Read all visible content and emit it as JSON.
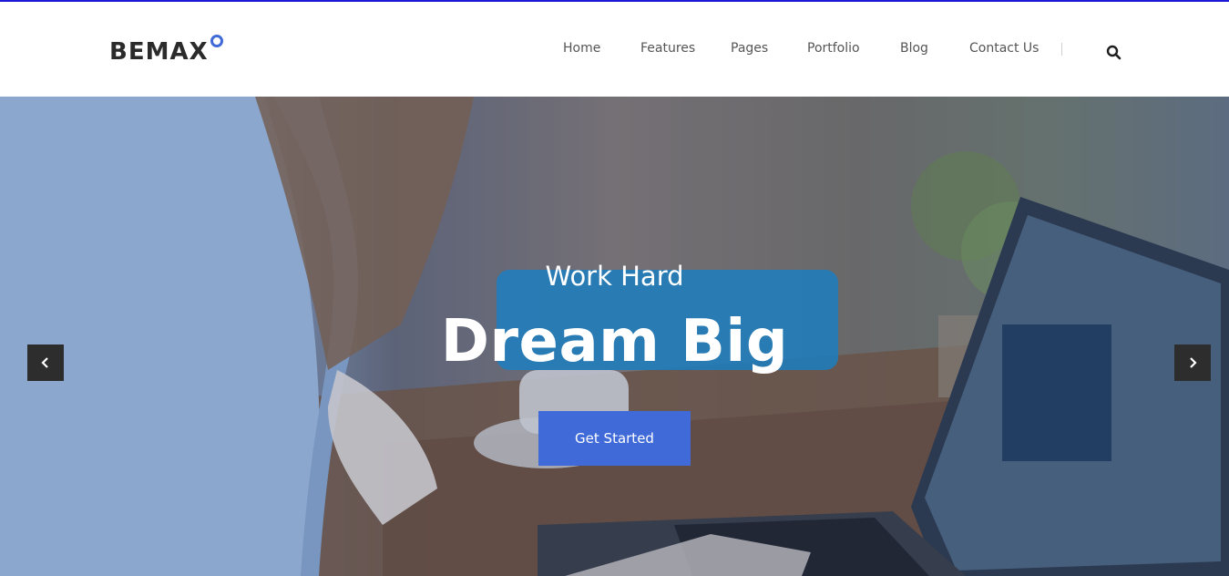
{
  "brand": {
    "name": "BEMAX",
    "accent": "#3f6ad8"
  },
  "nav": {
    "items": [
      {
        "label": "Home"
      },
      {
        "label": "Features"
      },
      {
        "label": "Pages"
      },
      {
        "label": "Portfolio"
      },
      {
        "label": "Blog"
      },
      {
        "label": "Contact Us"
      }
    ],
    "search_icon": "search-icon"
  },
  "hero": {
    "subtitle": "Work Hard",
    "title": "Dream Big",
    "cta_label": "Get Started",
    "prev_icon": "chevron-left-icon",
    "next_icon": "chevron-right-icon"
  }
}
